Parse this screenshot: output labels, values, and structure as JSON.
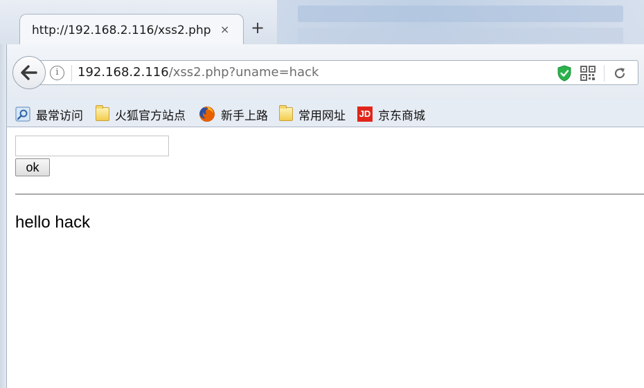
{
  "browser": {
    "tab": {
      "title": "http://192.168.2.116/xss2.php",
      "close_glyph": "×"
    },
    "new_tab_glyph": "+",
    "url": {
      "host": "192.168.2.116",
      "path": "/xss2.php?uname=hack"
    },
    "toolbar_icons": [
      "back-arrow-icon",
      "info-icon",
      "shield-icon",
      "qr-code-icon",
      "reload-icon"
    ],
    "bookmarks": [
      {
        "label": "最常访问",
        "icon": "most-visited-icon"
      },
      {
        "label": "火狐官方站点",
        "icon": "folder-icon"
      },
      {
        "label": "新手上路",
        "icon": "firefox-icon"
      },
      {
        "label": "常用网址",
        "icon": "folder-icon"
      },
      {
        "label": "京东商城",
        "icon": "jd-icon"
      }
    ],
    "jd_icon_text": "JD"
  },
  "page": {
    "input_value": "",
    "submit_label": "ok",
    "greeting": "hello hack"
  },
  "colors": {
    "shield_green": "#2bb24c",
    "jd_red": "#e1251b"
  }
}
